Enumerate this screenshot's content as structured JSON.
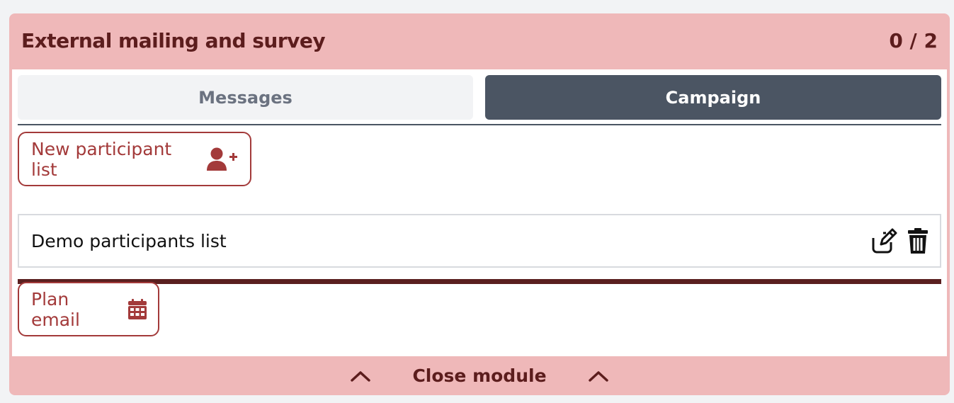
{
  "module": {
    "title": "External mailing and survey",
    "count": "0 / 2"
  },
  "tabs": [
    {
      "label": "Messages",
      "active": false
    },
    {
      "label": "Campaign",
      "active": true
    }
  ],
  "participants": {
    "new_list_label": "New participant list",
    "new_list_icon": "user-plus-icon",
    "lists": [
      {
        "name": "Demo participants list",
        "actions": [
          "edit-icon",
          "trash-icon"
        ]
      }
    ]
  },
  "email": {
    "plan_label": "Plan email",
    "plan_icon": "calendar-icon"
  },
  "footer": {
    "close_label": "Close module",
    "icon": "chevron-up-icon"
  },
  "colors": {
    "header_bg": "#efb8b9",
    "accent_dark": "#5c1d1d",
    "button_red": "#a33a3a",
    "active_tab": "#4b5563",
    "inactive_tab": "#f2f3f5"
  }
}
